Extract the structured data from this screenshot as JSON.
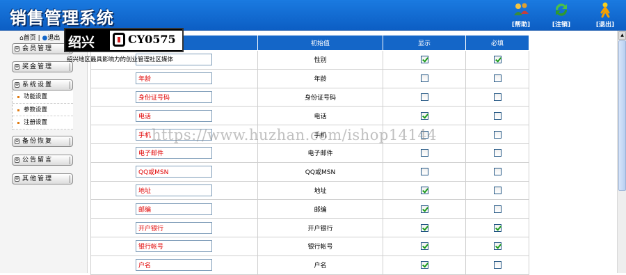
{
  "app": {
    "title": "销售管理系统"
  },
  "header": {
    "buttons": [
      {
        "label": "[帮助]",
        "icon": "people-help-icon"
      },
      {
        "label": "[注销]",
        "icon": "refresh-icon"
      },
      {
        "label": "[退出]",
        "icon": "exit-person-icon"
      }
    ]
  },
  "sidebar": {
    "home": "首页",
    "logout_partial": "退出",
    "menus": [
      {
        "label": "会员管理"
      },
      {
        "label": "奖金管理"
      },
      {
        "label": "系统设置"
      },
      {
        "label": "备份恢复"
      },
      {
        "label": "公告留言"
      },
      {
        "label": "其他管理"
      }
    ],
    "submenu": [
      {
        "label": "功能设置"
      },
      {
        "label": "参数设置"
      },
      {
        "label": "注册设置"
      }
    ]
  },
  "overlay": {
    "city": "绍兴",
    "code": "CY0575",
    "caption": "绍兴地区最具影响力的创业管理社区媒体"
  },
  "watermark": "https://www.huzhan.com/ishop14144",
  "table": {
    "headers": [
      "",
      "初始值",
      "显示",
      "必填"
    ],
    "rows": [
      {
        "name": "",
        "initial": "性别",
        "show": true,
        "required": true
      },
      {
        "name": "年龄",
        "initial": "年龄",
        "show": false,
        "required": false
      },
      {
        "name": "身份证号码",
        "initial": "身份证号码",
        "show": false,
        "required": false
      },
      {
        "name": "电话",
        "initial": "电话",
        "show": true,
        "required": false
      },
      {
        "name": "手机",
        "initial": "手机",
        "show": false,
        "required": false
      },
      {
        "name": "电子邮件",
        "initial": "电子邮件",
        "show": false,
        "required": false
      },
      {
        "name": "QQ或MSN",
        "initial": "QQ或MSN",
        "show": false,
        "required": false
      },
      {
        "name": "地址",
        "initial": "地址",
        "show": true,
        "required": false
      },
      {
        "name": "邮编",
        "initial": "邮编",
        "show": true,
        "required": false
      },
      {
        "name": "开户银行",
        "initial": "开户银行",
        "show": true,
        "required": true
      },
      {
        "name": "银行帐号",
        "initial": "银行帐号",
        "show": true,
        "required": true
      },
      {
        "name": "户名",
        "initial": "户名",
        "show": true,
        "required": false
      }
    ]
  },
  "colors": {
    "header_blue": "#1a7ae0",
    "table_header": "#1466c8",
    "field_text": "#e00000",
    "check_green": "#1a9a1a"
  }
}
